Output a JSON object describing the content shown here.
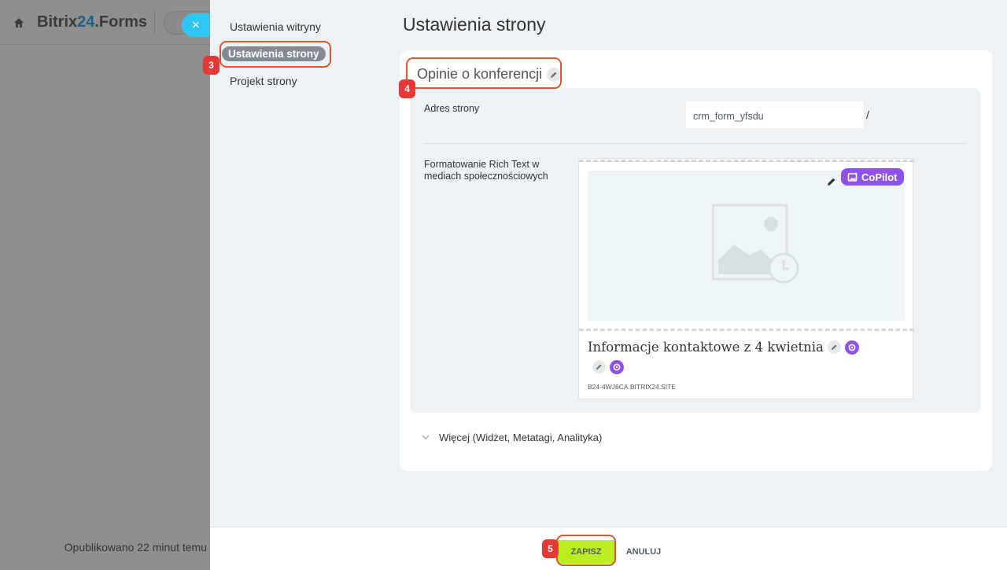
{
  "background": {
    "title_part1": "Bitrix",
    "title_num": "24",
    "title_part2": ".Forms",
    "published": "Opublikowano 22 minut temu"
  },
  "close_symbol": "×",
  "nav": {
    "items": [
      {
        "label": "Ustawienia witryny"
      },
      {
        "label": "Ustawienia strony"
      },
      {
        "label": "Projekt strony"
      }
    ],
    "active_index": 1
  },
  "page_title": "Ustawienia strony",
  "card": {
    "title": "Opinie o konferencji",
    "address": {
      "label": "Adres strony",
      "value": "crm_form_yfsdu",
      "suffix": "/"
    },
    "rich_text": {
      "label": "Formatowanie Rich Text w mediach społecznościowych",
      "copilot": "CoPilot",
      "preview_title": "Informacje kontaktowe z 4 kwietnia",
      "preview_url": "B24-4WJ6CA.BITRIX24.SITE"
    },
    "more": "Więcej (Widżet,  Metatagi,  Analityka)"
  },
  "footer": {
    "save": "ZAPISZ",
    "cancel": "ANULUJ"
  },
  "annotations": {
    "nav_step": "3",
    "title_step": "4",
    "save_step": "5"
  },
  "colors": {
    "accent_close": "#2fc6f6",
    "save_button": "#bbed21",
    "copilot": "#8e52ec",
    "annotation": "#e0552c"
  }
}
